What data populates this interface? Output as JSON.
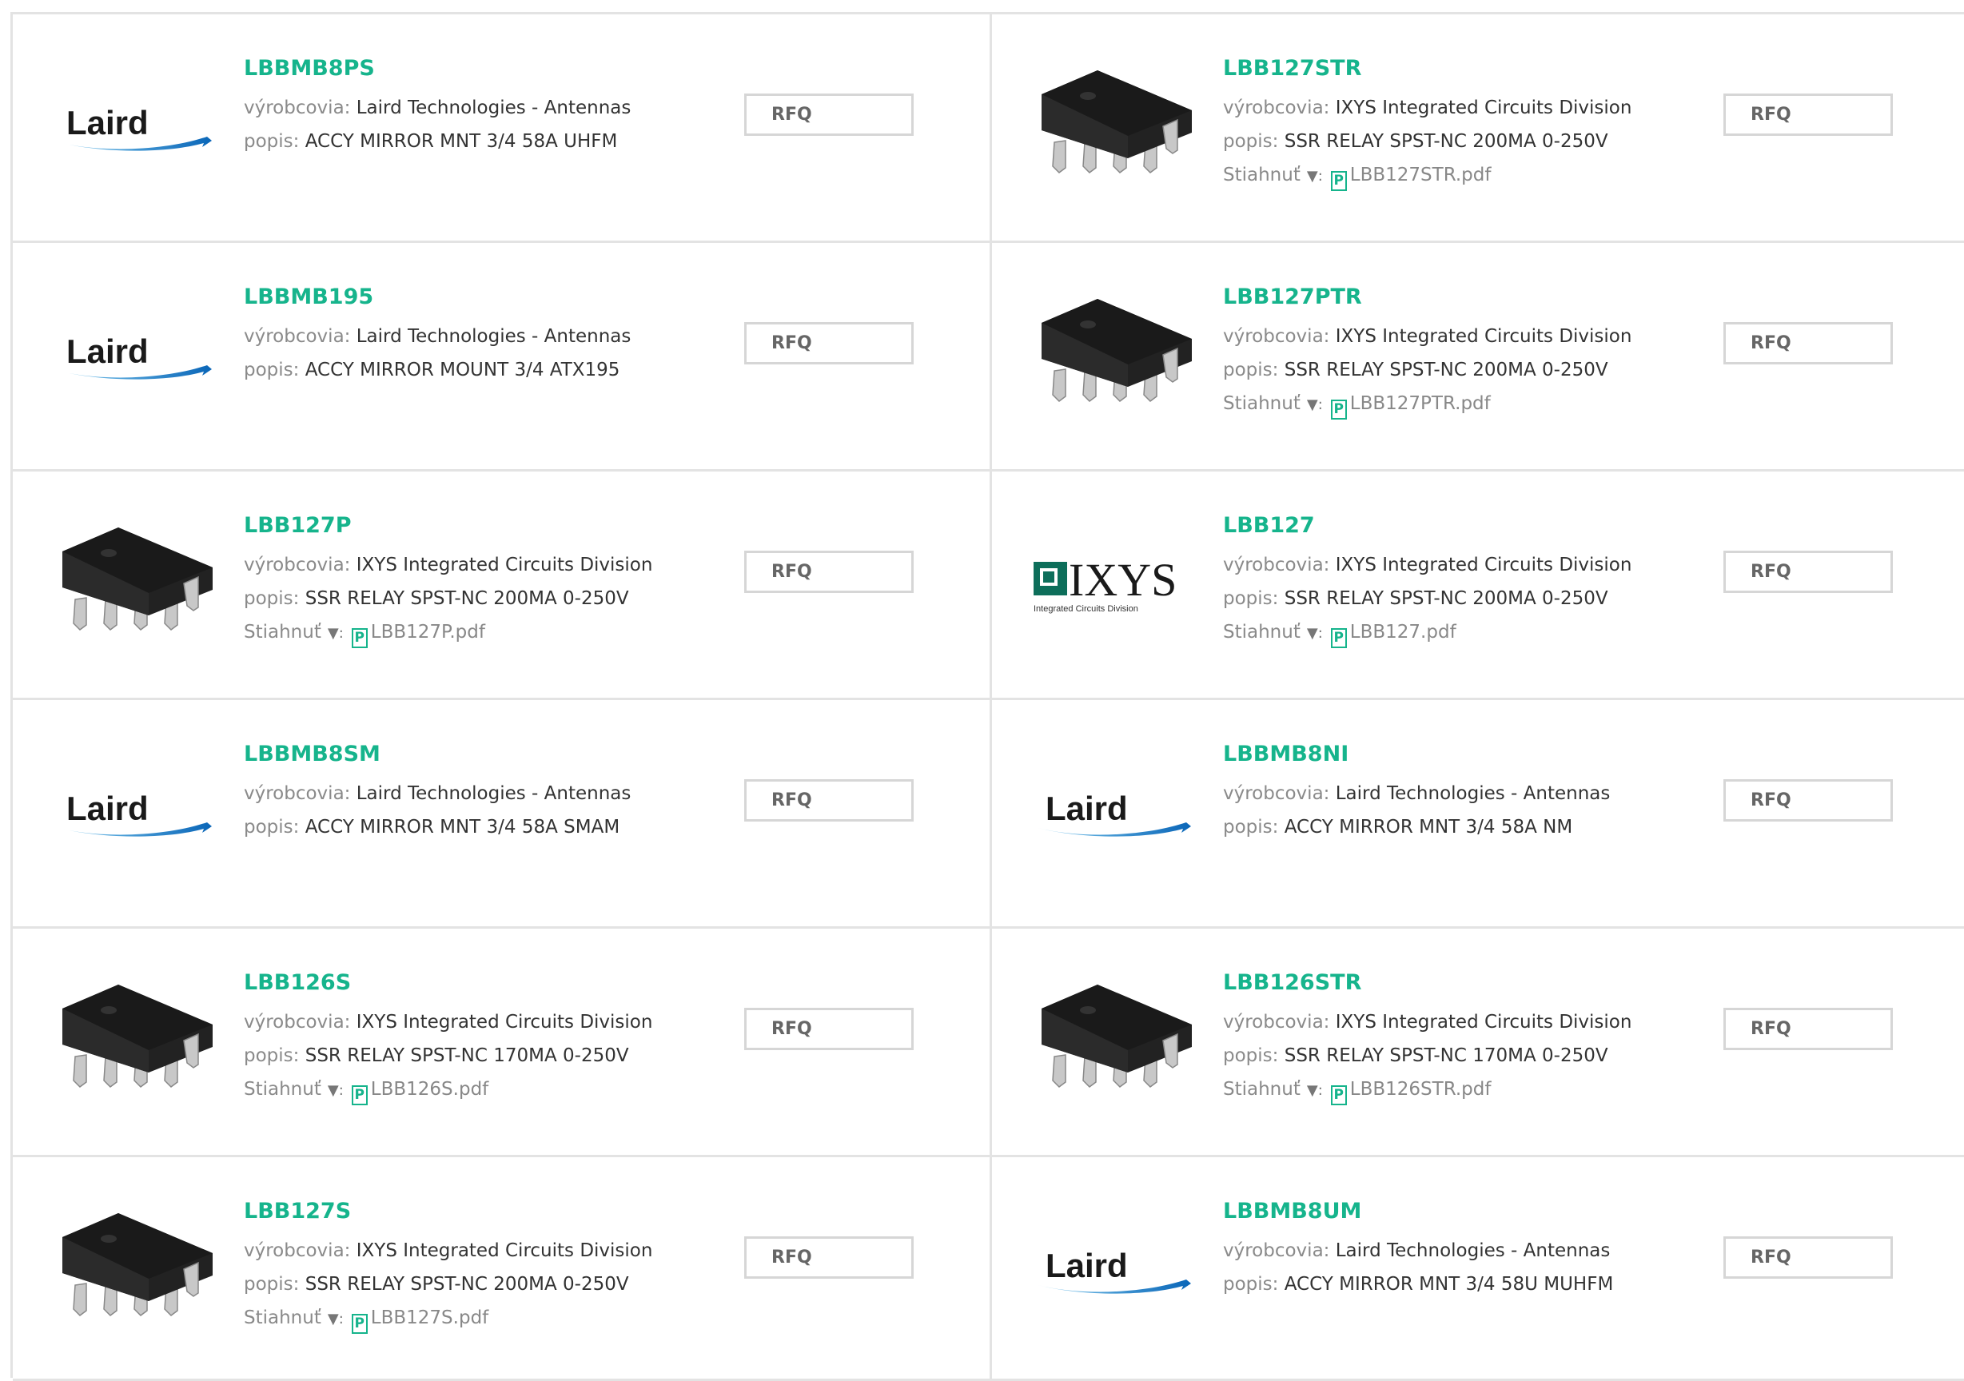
{
  "labels": {
    "manufacturer": "výrobcovia:",
    "description": "popis:",
    "download": "Stiahnuť",
    "download_arrow": "▼:",
    "rfq": "RFQ"
  },
  "products": [
    {
      "part": "LBBMB8PS",
      "manufacturer": "Laird Technologies - Antennas",
      "description": "ACCY MIRROR MNT 3/4 58A UHFM",
      "pdf": "",
      "image": "laird-logo"
    },
    {
      "part": "LBB127STR",
      "manufacturer": "IXYS Integrated Circuits Division",
      "description": "SSR RELAY SPST-NC 200MA 0-250V",
      "pdf": "LBB127STR.pdf",
      "image": "ic-chip"
    },
    {
      "part": "LBBMB195",
      "manufacturer": "Laird Technologies - Antennas",
      "description": "ACCY MIRROR MOUNT 3/4 ATX195",
      "pdf": "",
      "image": "laird-logo"
    },
    {
      "part": "LBB127PTR",
      "manufacturer": "IXYS Integrated Circuits Division",
      "description": "SSR RELAY SPST-NC 200MA 0-250V",
      "pdf": "LBB127PTR.pdf",
      "image": "ic-chip"
    },
    {
      "part": "LBB127P",
      "manufacturer": "IXYS Integrated Circuits Division",
      "description": "SSR RELAY SPST-NC 200MA 0-250V",
      "pdf": "LBB127P.pdf",
      "image": "ic-chip"
    },
    {
      "part": "LBB127",
      "manufacturer": "IXYS Integrated Circuits Division",
      "description": "SSR RELAY SPST-NC 200MA 0-250V",
      "pdf": "LBB127.pdf",
      "image": "ixys-logo"
    },
    {
      "part": "LBBMB8SM",
      "manufacturer": "Laird Technologies - Antennas",
      "description": "ACCY MIRROR MNT 3/4 58A SMAM",
      "pdf": "",
      "image": "laird-logo"
    },
    {
      "part": "LBBMB8NI",
      "manufacturer": "Laird Technologies - Antennas",
      "description": "ACCY MIRROR MNT 3/4 58A NM",
      "pdf": "",
      "image": "laird-logo"
    },
    {
      "part": "LBB126S",
      "manufacturer": "IXYS Integrated Circuits Division",
      "description": "SSR RELAY SPST-NC 170MA 0-250V",
      "pdf": "LBB126S.pdf",
      "image": "ic-chip"
    },
    {
      "part": "LBB126STR",
      "manufacturer": "IXYS Integrated Circuits Division",
      "description": "SSR RELAY SPST-NC 170MA 0-250V",
      "pdf": "LBB126STR.pdf",
      "image": "ic-chip"
    },
    {
      "part": "LBB127S",
      "manufacturer": "IXYS Integrated Circuits Division",
      "description": "SSR RELAY SPST-NC 200MA 0-250V",
      "pdf": "LBB127S.pdf",
      "image": "ic-chip"
    },
    {
      "part": "LBBMB8UM",
      "manufacturer": "Laird Technologies - Antennas",
      "description": "ACCY MIRROR MNT 3/4 58U MUHFM",
      "pdf": "",
      "image": "laird-logo"
    }
  ],
  "logos": {
    "laird_text": "Laird",
    "ixys_text": "IXYS",
    "ixys_subtext": "Integrated Circuits Division"
  },
  "colors": {
    "accent": "#16b48c",
    "border": "#e3e3e3",
    "label": "#8a8a8a",
    "text": "#333333"
  }
}
